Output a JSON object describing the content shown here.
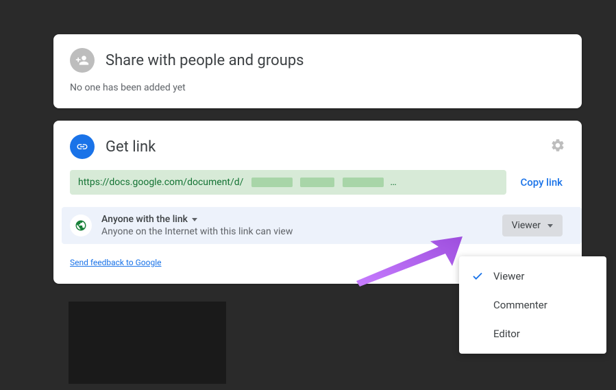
{
  "share": {
    "title": "Share with people and groups",
    "empty_text": "No one has been added yet"
  },
  "link": {
    "title": "Get link",
    "url_visible": "https://docs.google.com/document/d/",
    "copy_label": "Copy link",
    "access": {
      "title": "Anyone with the link",
      "desc": "Anyone on the Internet with this link can view"
    },
    "role_selected": "Viewer",
    "feedback": "Send feedback to Google"
  },
  "role_menu": {
    "options": [
      "Viewer",
      "Commenter",
      "Editor"
    ],
    "selected": "Viewer"
  }
}
